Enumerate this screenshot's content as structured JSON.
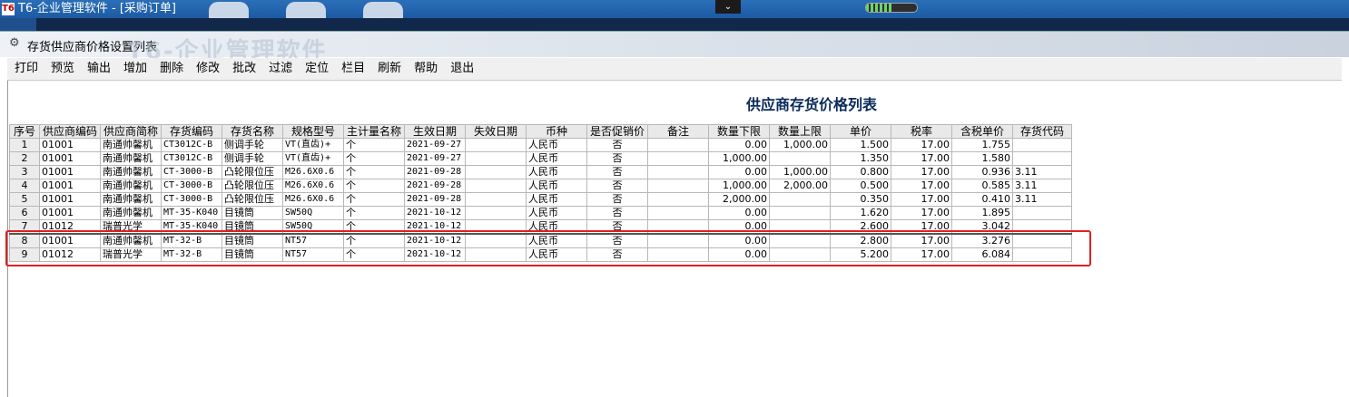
{
  "window": {
    "title": "T6-企业管理软件 - [采购订单]",
    "app_icon_text": "T6",
    "chevron_icon": "chevron-down-icon",
    "progress_fraction": 0.5
  },
  "form": {
    "title": "存货供应商价格设置列表",
    "watermark": "T6-企业管理软件"
  },
  "toolbar": {
    "items": [
      "打印",
      "预览",
      "输出",
      "增加",
      "删除",
      "修改",
      "批改",
      "过滤",
      "定位",
      "栏目",
      "刷新",
      "帮助",
      "退出"
    ]
  },
  "report": {
    "title": "供应商存货价格列表"
  },
  "table": {
    "columns": [
      "序号",
      "供应商编码",
      "供应商简称",
      "存货编码",
      "存货名称",
      "规格型号",
      "主计量名称",
      "生效日期",
      "失效日期",
      "币种",
      "是否促销价",
      "备注",
      "数量下限",
      "数量上限",
      "单价",
      "税率",
      "含税单价",
      "存货代码"
    ],
    "rows": [
      [
        "1",
        "01001",
        "南通帅馨机",
        "CT3012C-B",
        "侧调手轮",
        "VT(直齿)+",
        "个",
        "2021-09-27",
        "",
        "人民币",
        "否",
        "",
        "0.00",
        "1,000.00",
        "1.500",
        "17.00",
        "1.755",
        ""
      ],
      [
        "2",
        "01001",
        "南通帅馨机",
        "CT3012C-B",
        "侧调手轮",
        "VT(直齿)+",
        "个",
        "2021-09-27",
        "",
        "人民币",
        "否",
        "",
        "1,000.00",
        "",
        "1.350",
        "17.00",
        "1.580",
        ""
      ],
      [
        "3",
        "01001",
        "南通帅馨机",
        "CT-3000-B",
        "凸轮限位压",
        "M26.6X0.6",
        "个",
        "2021-09-28",
        "",
        "人民币",
        "否",
        "",
        "0.00",
        "1,000.00",
        "0.800",
        "17.00",
        "0.936",
        "3.11"
      ],
      [
        "4",
        "01001",
        "南通帅馨机",
        "CT-3000-B",
        "凸轮限位压",
        "M26.6X0.6",
        "个",
        "2021-09-28",
        "",
        "人民币",
        "否",
        "",
        "1,000.00",
        "2,000.00",
        "0.500",
        "17.00",
        "0.585",
        "3.11"
      ],
      [
        "5",
        "01001",
        "南通帅馨机",
        "CT-3000-B",
        "凸轮限位压",
        "M26.6X0.6",
        "个",
        "2021-09-28",
        "",
        "人民币",
        "否",
        "",
        "2,000.00",
        "",
        "0.350",
        "17.00",
        "0.410",
        "3.11"
      ],
      [
        "6",
        "01001",
        "南通帅馨机",
        "MT-35-K040",
        "目镜筒",
        "SW50Q",
        "个",
        "2021-10-12",
        "",
        "人民币",
        "否",
        "",
        "0.00",
        "",
        "1.620",
        "17.00",
        "1.895",
        ""
      ],
      [
        "7",
        "01012",
        "瑞普光学",
        "MT-35-K040",
        "目镜筒",
        "SW50Q",
        "个",
        "2021-10-12",
        "",
        "人民币",
        "否",
        "",
        "0.00",
        "",
        "2.600",
        "17.00",
        "3.042",
        ""
      ],
      [
        "8",
        "01001",
        "南通帅馨机",
        "MT-32-B",
        "目镜筒",
        "NT57",
        "个",
        "2021-10-12",
        "",
        "人民币",
        "否",
        "",
        "0.00",
        "",
        "2.800",
        "17.00",
        "3.276",
        ""
      ],
      [
        "9",
        "01012",
        "瑞普光学",
        "MT-32-B",
        "目镜筒",
        "NT57",
        "个",
        "2021-10-12",
        "",
        "人民币",
        "否",
        "",
        "0.00",
        "",
        "5.200",
        "17.00",
        "6.084",
        ""
      ]
    ]
  },
  "colors": {
    "titlebar": "#1c5aa3",
    "highlight": "#e02020",
    "report_title": "#0a2a5a"
  }
}
